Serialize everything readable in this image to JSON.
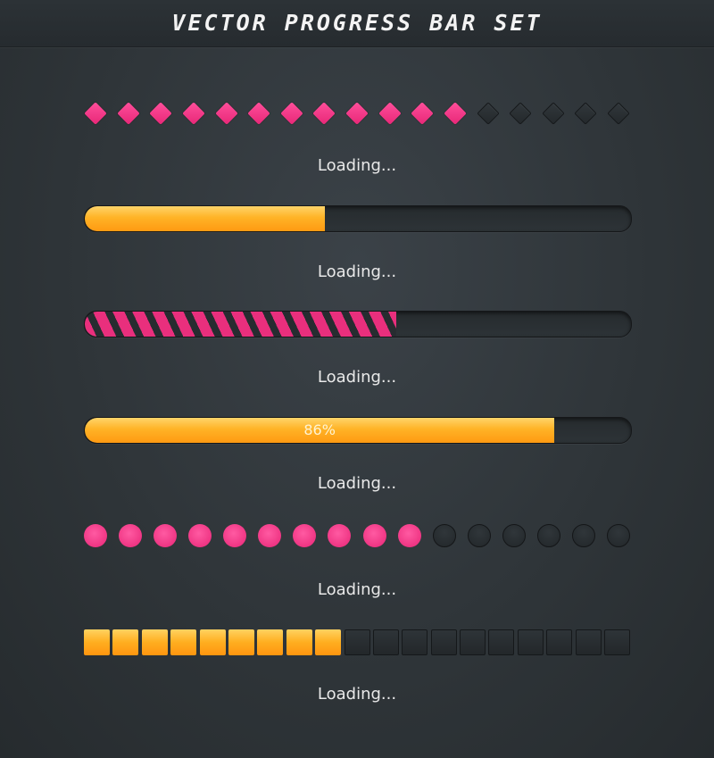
{
  "header": {
    "title": "VECTOR PROGRESS BAR SET"
  },
  "loading_label": "Loading...",
  "colors": {
    "pink": "#e92f7d",
    "orange": "#ffb326",
    "track": "#2a2f33"
  },
  "bars": [
    {
      "style": "diamonds",
      "filled": 12,
      "total": 17
    },
    {
      "style": "bar-orange",
      "progress_fraction": 0.44
    },
    {
      "style": "bar-striped-pink",
      "progress_fraction": 0.57
    },
    {
      "style": "bar-orange-percent",
      "progress_fraction": 0.86,
      "percent_label": "86%"
    },
    {
      "style": "dots",
      "filled": 10,
      "total": 16
    },
    {
      "style": "squares",
      "filled": 9,
      "total": 19
    }
  ]
}
